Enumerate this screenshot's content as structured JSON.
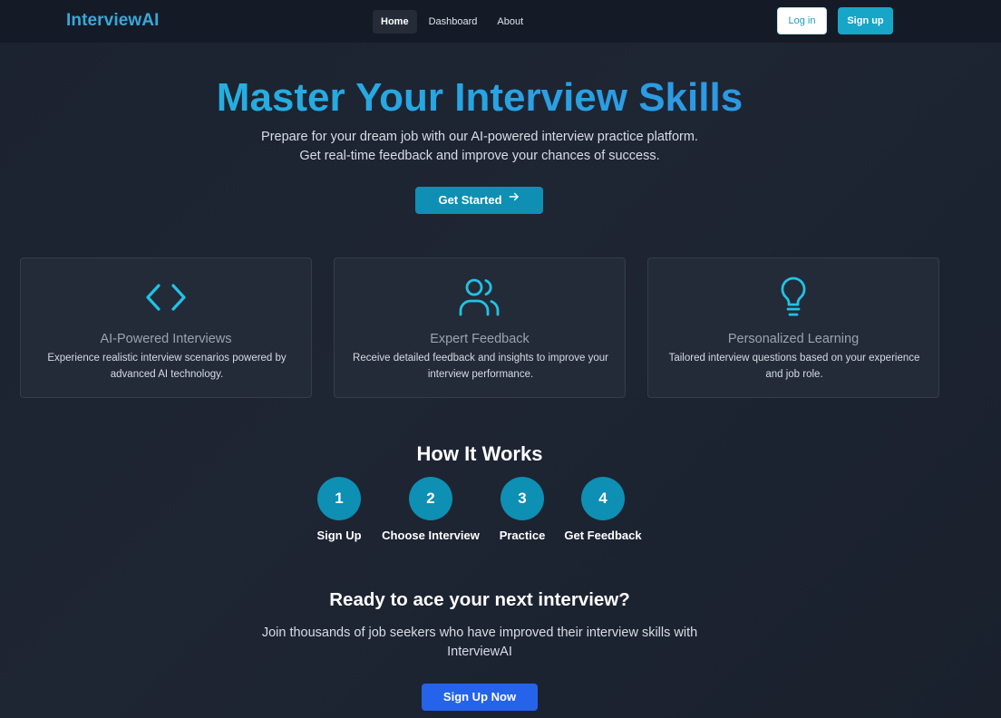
{
  "nav": {
    "brand": "InterviewAI",
    "links": [
      {
        "label": "Home",
        "active": true
      },
      {
        "label": "Dashboard",
        "active": false
      },
      {
        "label": "About",
        "active": false
      }
    ],
    "login_label": "Log in",
    "signup_label": "Sign up"
  },
  "hero": {
    "title": "Master Your Interview Skills",
    "subtitle": "Prepare for your dream job with our AI-powered interview practice platform. Get real-time feedback and improve your chances of success.",
    "cta_label": "Get Started",
    "cta_icon": "arrow-right-icon"
  },
  "features": [
    {
      "icon": "code-brackets-icon",
      "title": "AI-Powered Interviews",
      "description": "Experience realistic interview scenarios powered by advanced AI technology."
    },
    {
      "icon": "users-icon",
      "title": "Expert Feedback",
      "description": "Receive detailed feedback and insights to improve your interview performance."
    },
    {
      "icon": "lightbulb-icon",
      "title": "Personalized Learning",
      "description": "Tailored interview questions based on your experience and job role."
    }
  ],
  "how_it_works": {
    "title": "How It Works",
    "steps": [
      {
        "number": "1",
        "label": "Sign Up"
      },
      {
        "number": "2",
        "label": "Choose Interview"
      },
      {
        "number": "3",
        "label": "Practice"
      },
      {
        "number": "4",
        "label": "Get Feedback"
      }
    ]
  },
  "cta": {
    "title": "Ready to ace your next interview?",
    "subtitle": "Join thousands of job seekers who have improved their interview skills with InterviewAI",
    "button_label": "Sign Up Now"
  },
  "colors": {
    "accent": "#17a5c8",
    "icon": "#22c3e6",
    "primary_button": "#2563eb",
    "background": "#1e2533"
  }
}
